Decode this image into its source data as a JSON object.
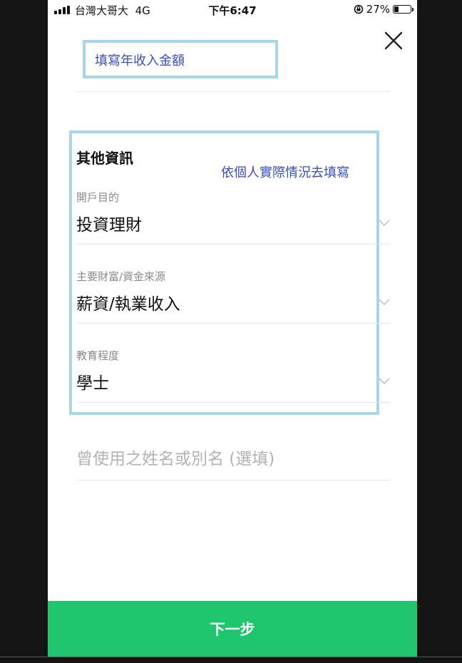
{
  "status_bar": {
    "carrier": "台灣大哥大",
    "network": "4G",
    "time": "下午6:47",
    "battery": "27%",
    "battery_level": 0.27
  },
  "annotations": {
    "income_hint": "填寫年收入金額",
    "other_info_hint": "依個人實際情況去填寫",
    "border_color": "#a6d8ea",
    "text_color": "#3a4fb8"
  },
  "section": {
    "title": "其他資訊"
  },
  "fields": [
    {
      "label": "開戶目的",
      "value": "投資理財"
    },
    {
      "label": "主要財富/資金來源",
      "value": "薪資/執業收入"
    },
    {
      "label": "教育程度",
      "value": "學士"
    }
  ],
  "alias_input": {
    "placeholder": "曾使用之姓名或別名 (選填)",
    "value": ""
  },
  "next_button": {
    "label": "下一步",
    "color": "#1fc66e"
  }
}
